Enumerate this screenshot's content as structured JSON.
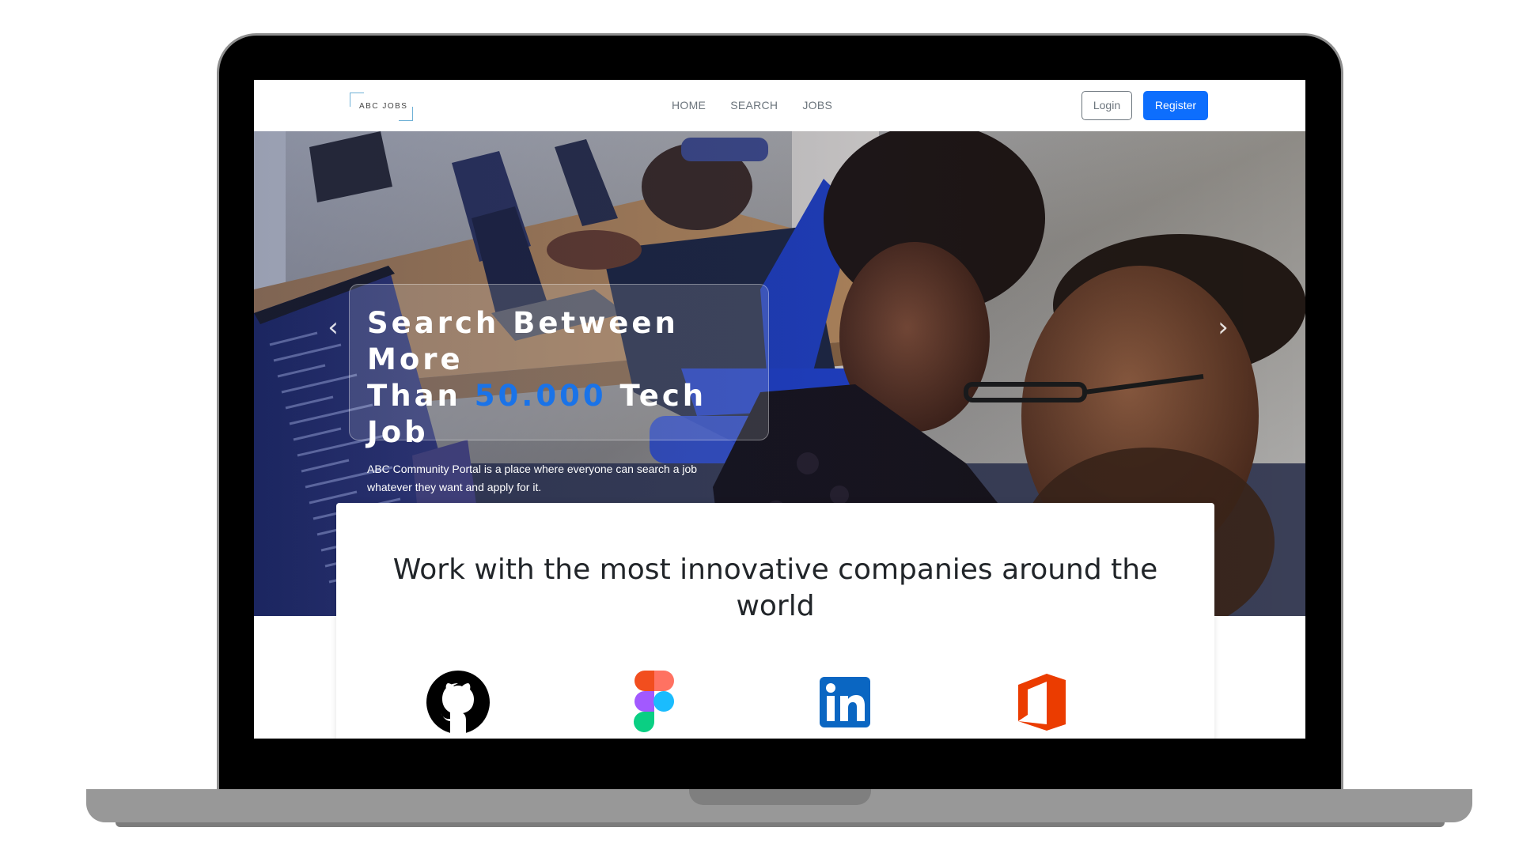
{
  "logo": {
    "text": "ABC JOBS"
  },
  "nav": {
    "links": [
      "HOME",
      "SEARCH",
      "JOBS"
    ],
    "login_label": "Login",
    "register_label": "Register"
  },
  "hero": {
    "heading_line1": "Search Between More",
    "heading_line2_pre": "Than ",
    "heading_highlight": "50.000",
    "heading_line2_post": " Tech Job",
    "subtitle": "ABC Community Portal is a place where everyone can search a job whatever they want and apply for it.",
    "prev_icon": "chevron-left-icon",
    "next_icon": "chevron-right-icon"
  },
  "companies": {
    "heading": "Work with the most innovative companies around the world",
    "logos": [
      "github-icon",
      "figma-icon",
      "linkedin-icon",
      "office-icon"
    ]
  },
  "colors": {
    "primary": "#0d6efd",
    "accent_text": "#1a73e8",
    "nav_text": "#6c757d",
    "laptop_frame": "#000000",
    "laptop_base": "#989898"
  }
}
